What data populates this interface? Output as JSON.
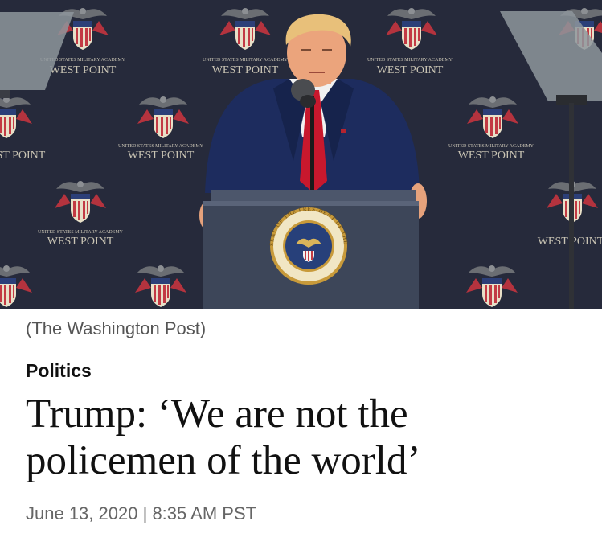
{
  "photo": {
    "backdrop_text": "WEST POINT",
    "backdrop_subtext": "UNITED STATES MILITARY ACADEMY",
    "seal_text": "SEAL OF THE PRESIDENT OF THE UNITED STATES"
  },
  "article": {
    "caption": "(The Washington Post)",
    "section": "Politics",
    "headline": "Trump: ‘We are not the policemen of the world’",
    "date": "June 13, 2020",
    "separator": "|",
    "time": "8:35 AM PST"
  }
}
